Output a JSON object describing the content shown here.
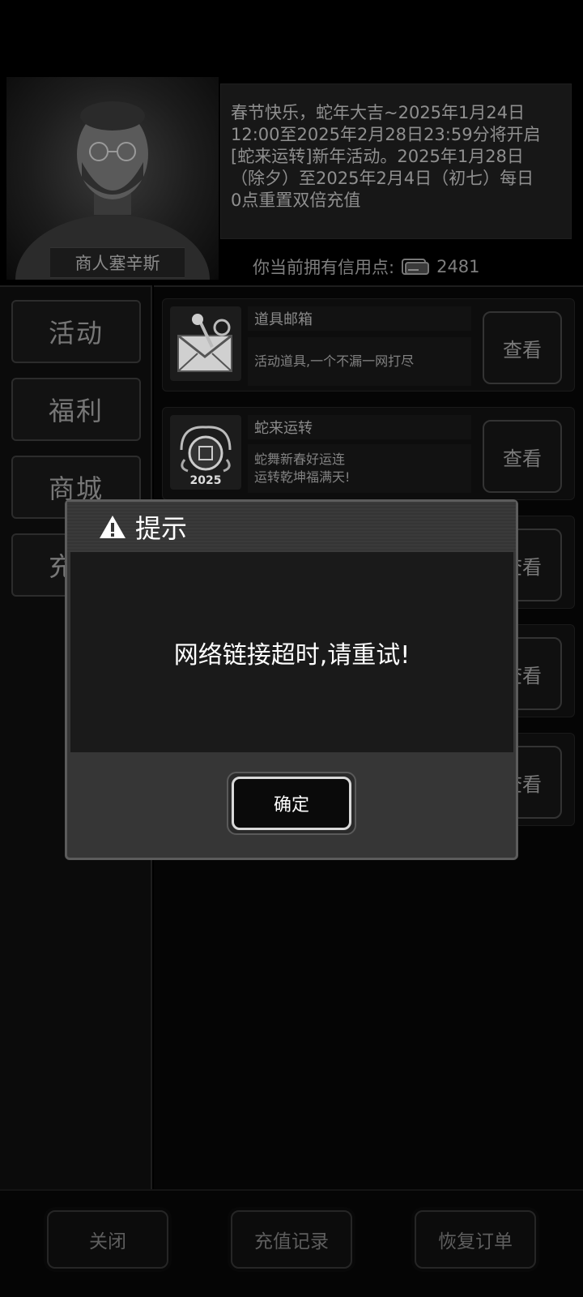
{
  "merchant": {
    "name": "商人塞辛斯"
  },
  "notice": {
    "lines": [
      "春节快乐，蛇年大吉~2025年1月24日",
      "12:00至2025年2月28日23:59分将开启",
      "[蛇来运转]新年活动。2025年1月28日",
      "（除夕）至2025年2月4日（初七）每日",
      "0点重置双倍充值"
    ]
  },
  "credits": {
    "label": "你当前拥有信用点:",
    "value": "2481",
    "icon": "credit-card-icon"
  },
  "sidebar": {
    "items": [
      {
        "label": "活动"
      },
      {
        "label": "福利"
      },
      {
        "label": "商城"
      },
      {
        "label": "充"
      }
    ]
  },
  "activities": [
    {
      "title": "道具邮箱",
      "desc": [
        "活动道具,一个不漏一网打尽"
      ],
      "button": "查看",
      "icon": "mailbox-pin-icon"
    },
    {
      "title": "蛇来运转",
      "desc": [
        "蛇舞新春好运连",
        "运转乾坤福满天!"
      ],
      "button": "查看",
      "icon": "snake-2025-emblem-icon",
      "emblem_text": "2025"
    }
  ],
  "hidden_buttons": [
    "查看",
    "查看",
    "查看"
  ],
  "bottom": {
    "close": "关闭",
    "history": "充值记录",
    "restore": "恢复订单"
  },
  "dialog": {
    "title": "提示",
    "icon": "warning-icon",
    "message": "网络链接超时,请重试!",
    "confirm": "确定"
  }
}
